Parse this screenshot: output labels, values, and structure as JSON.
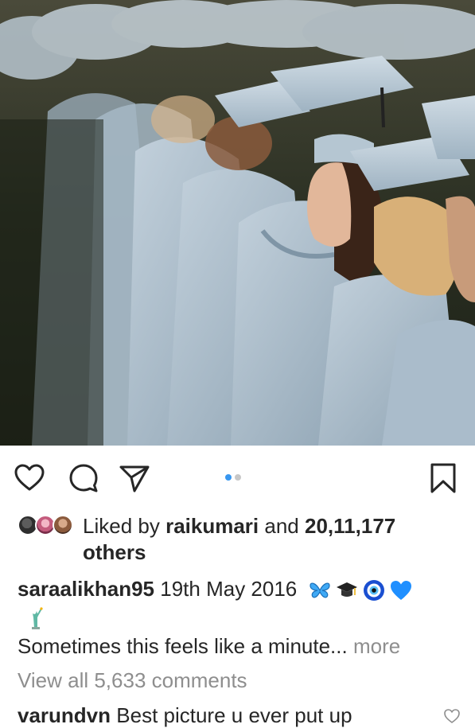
{
  "post": {
    "likes": {
      "prefix": "Liked by",
      "user": "raikumari",
      "conjunction": "and",
      "count": "20,11,177",
      "suffix": "others"
    },
    "caption": {
      "username": "saraalikhan95",
      "text": "19th May 2016",
      "emojis": [
        "butterfly-icon",
        "graduation-cap-icon",
        "nazar-amulet-icon",
        "blue-heart-icon",
        "statue-of-liberty-icon"
      ],
      "line2": "Sometimes this feels like a minute...",
      "more": "more"
    },
    "view_all_comments": "View all 5,633 comments",
    "comments": [
      {
        "username": "varundvn",
        "text": "Best picture u ever put up"
      }
    ],
    "carousel": {
      "count": 2,
      "active": 0
    },
    "colors": {
      "accent": "#3897f0",
      "muted": "#8e8e8e",
      "text": "#262626",
      "gown": "#a9bccb"
    }
  }
}
